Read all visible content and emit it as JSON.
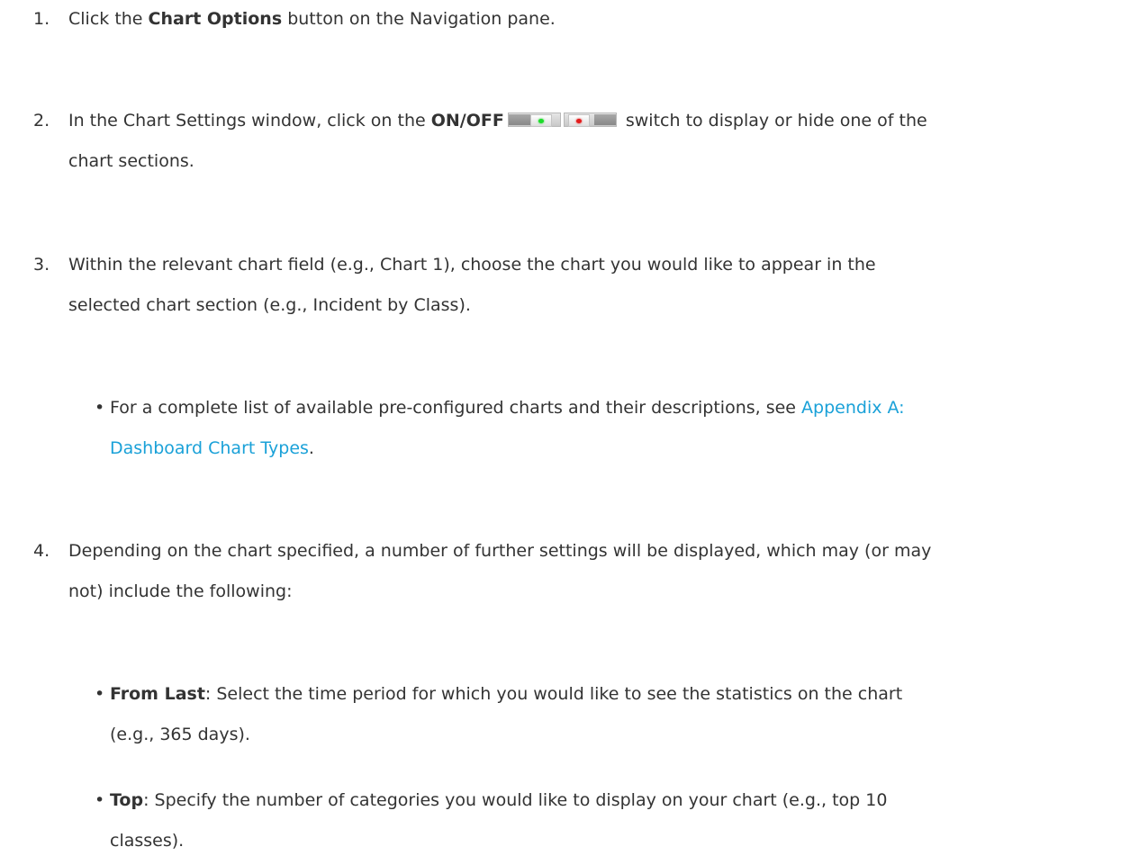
{
  "steps": [
    {
      "number": "1.",
      "pre": "Click the ",
      "bold": "Chart Options",
      "post": " button on the Navigation pane."
    },
    {
      "number": "2.",
      "pre": "In the Chart Settings window, click on the ",
      "bold": "ON/OFF",
      "post": " switch to display or hide one of the",
      "line2": "chart sections.",
      "switch_on_icon": "switch-on-icon",
      "switch_off_icon": "switch-off-icon",
      "on_color": "#1ddc2a",
      "off_color": "#e31b1b"
    },
    {
      "number": "3.",
      "line1": "Within the relevant chart field (e.g., Chart 1), choose the chart you would like to appear in the",
      "line2": "selected chart section (e.g., Incident by Class)."
    },
    {
      "number": "4.",
      "line1": "Depending on the chart specified, a number of further settings will be displayed, which may (or may",
      "line2": "not) include the following:"
    }
  ],
  "bullets": [
    {
      "marker": "•",
      "pre": "For a complete list of available pre-configured charts and their descriptions, see ",
      "link_part1": "Appendix A:",
      "link_part2": "Dashboard Chart Types",
      "post": "."
    },
    {
      "marker": "•",
      "bold": "From Last",
      "text": ": Select the time period for which you would like to see the statistics on the chart",
      "line2": "(e.g., 365 days)."
    },
    {
      "marker": "•",
      "bold": "Top",
      "text": ": Specify the number of categories you would like to display on your chart (e.g., top 10",
      "line2": "classes)."
    }
  ],
  "link_color": "#1aa1d8"
}
